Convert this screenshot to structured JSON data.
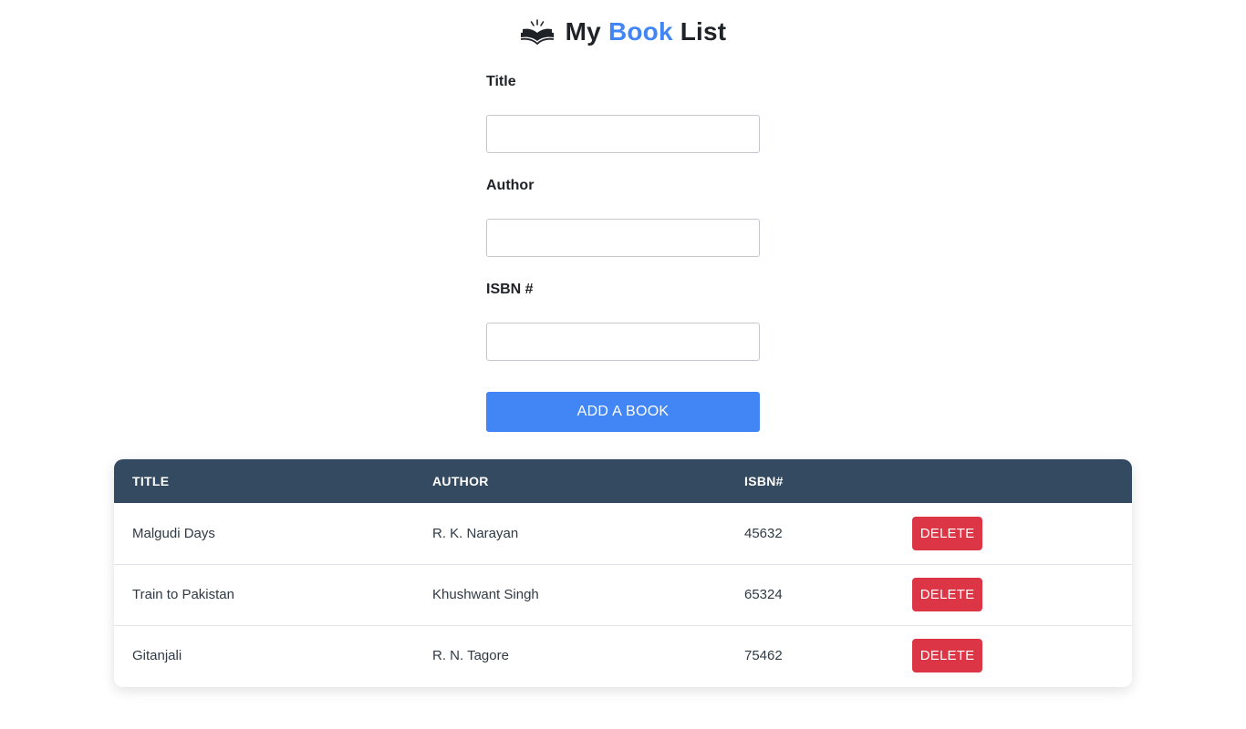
{
  "header": {
    "title_prefix": "My",
    "title_accent": "Book",
    "title_suffix": "List",
    "logo_icon": "open-book-icon",
    "accent_color": "#4285f4"
  },
  "form": {
    "title_label": "Title",
    "title_value": "",
    "author_label": "Author",
    "author_value": "",
    "isbn_label": "ISBN #",
    "isbn_value": "",
    "submit_label": "ADD A BOOK"
  },
  "table": {
    "header_color": "#344a60",
    "columns": [
      "TITLE",
      "AUTHOR",
      "ISBN#",
      ""
    ],
    "rows": [
      {
        "title": "Malgudi Days",
        "author": "R. K. Narayan",
        "isbn": "45632",
        "action": "DELETE"
      },
      {
        "title": "Train to Pakistan",
        "author": "Khushwant Singh",
        "isbn": "65324",
        "action": "DELETE"
      },
      {
        "title": "Gitanjali",
        "author": "R. N. Tagore",
        "isbn": "75462",
        "action": "DELETE"
      }
    ],
    "delete_color": "#dc3545"
  }
}
